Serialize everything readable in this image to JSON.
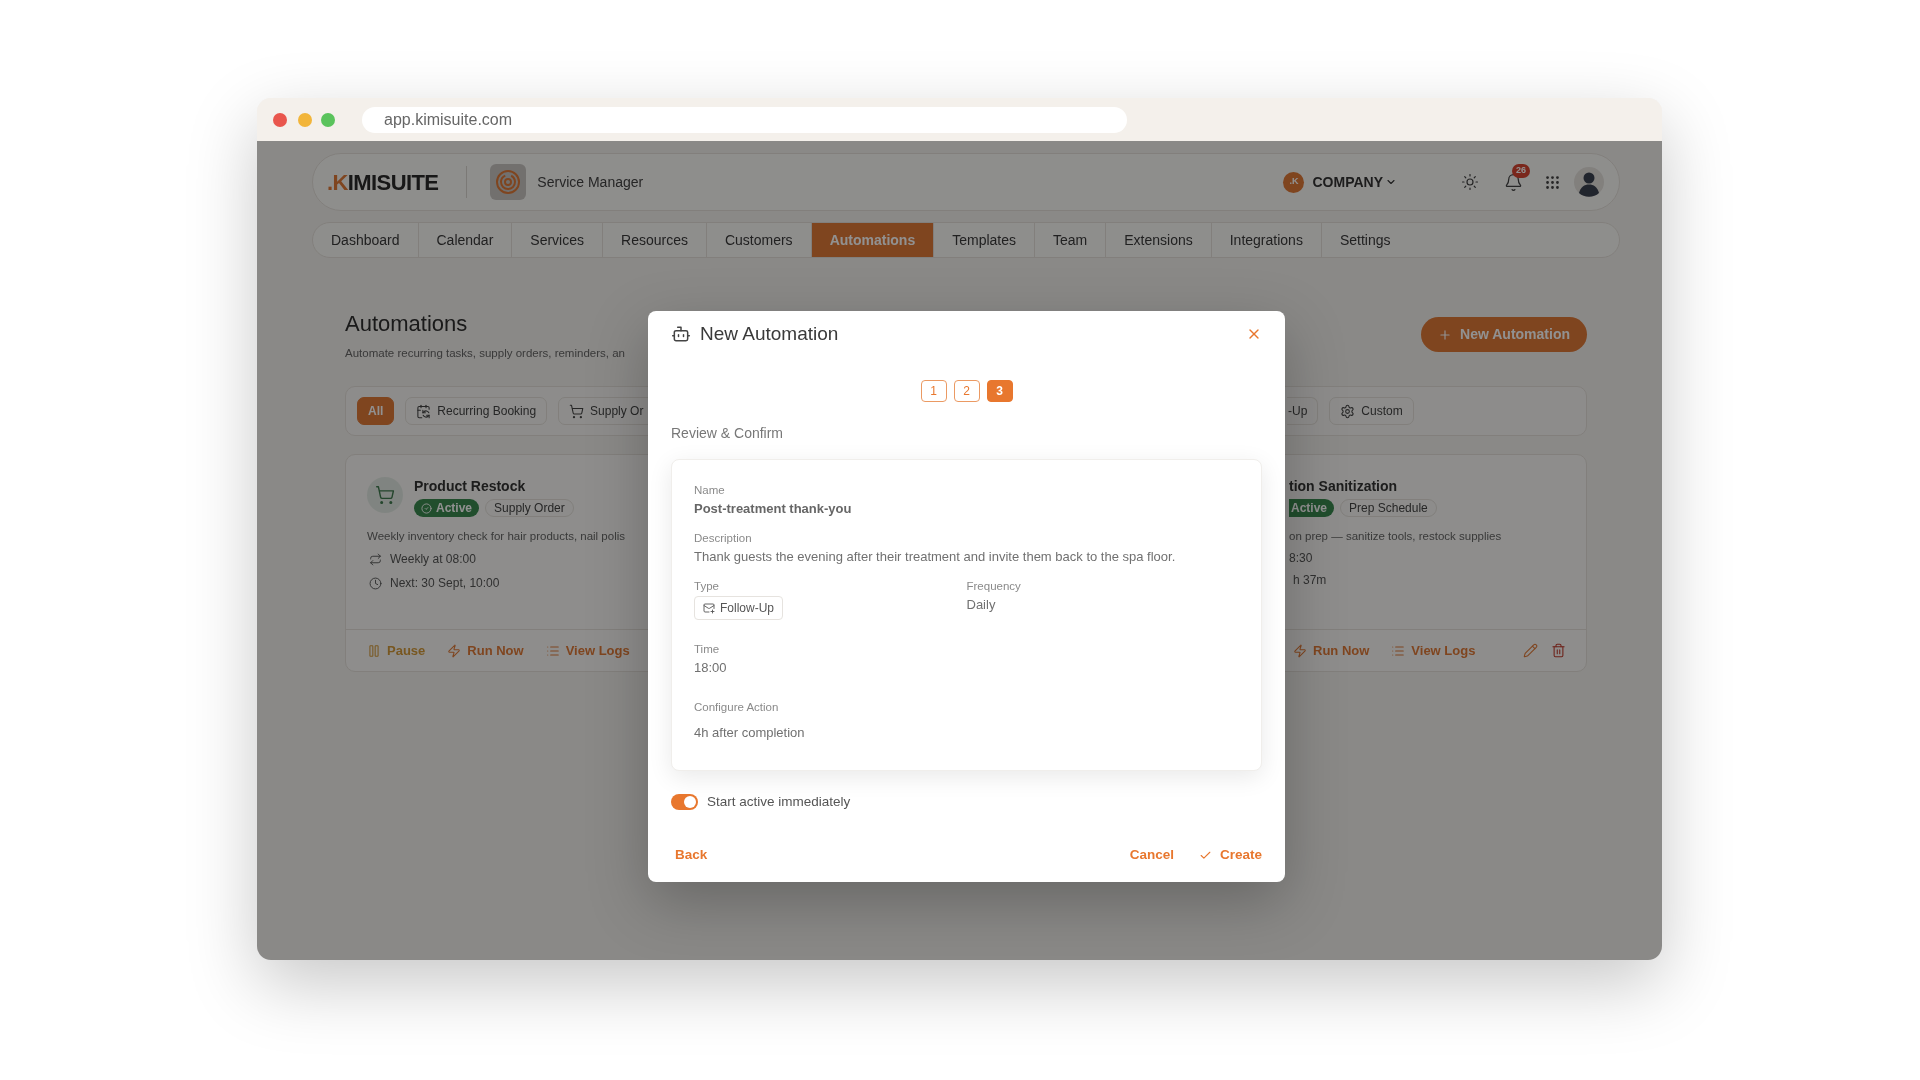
{
  "browser": {
    "url": "app.kimisuite.com"
  },
  "header": {
    "logo": ".KIMISUITE",
    "app_name": "Service Manager",
    "company": {
      "initial": ".K",
      "name": "COMPANY"
    },
    "notification_count": "26"
  },
  "nav": {
    "tabs": [
      {
        "label": "Dashboard",
        "selected": false
      },
      {
        "label": "Calendar",
        "selected": false
      },
      {
        "label": "Services",
        "selected": false
      },
      {
        "label": "Resources",
        "selected": false
      },
      {
        "label": "Customers",
        "selected": false
      },
      {
        "label": "Automations",
        "selected": true
      },
      {
        "label": "Templates",
        "selected": false
      },
      {
        "label": "Team",
        "selected": false
      },
      {
        "label": "Extensions",
        "selected": false
      },
      {
        "label": "Integrations",
        "selected": false
      },
      {
        "label": "Settings",
        "selected": false
      }
    ]
  },
  "page": {
    "title": "Automations",
    "subtitle": "Automate recurring tasks, supply orders, reminders, an",
    "new_button": "New Automation"
  },
  "filters": {
    "left_of_dialog": [
      {
        "label": "All",
        "selected": true
      },
      {
        "label": "Recurring Booking",
        "selected": false
      },
      {
        "label": "Supply Or",
        "selected": false
      }
    ],
    "right_of_dialog": [
      {
        "label": "-Up",
        "selected": false
      },
      {
        "label": "Custom",
        "selected": false
      }
    ]
  },
  "cards": [
    {
      "title": "Product Restock",
      "status": "Active",
      "category": "Supply Order",
      "description": "Weekly inventory check for hair products, nail polis",
      "schedule": "Weekly at 08:00",
      "next_run": "Next: 30 Sept, 10:00",
      "actions": [
        {
          "kind": "pause",
          "label": "Pause"
        },
        {
          "kind": "run",
          "label": "Run Now"
        },
        {
          "kind": "logs",
          "label": "View Logs"
        }
      ]
    },
    {
      "title": "tion Sanitization",
      "status": "Active",
      "category": "Prep Schedule",
      "description": "on prep — sanitize tools, restock supplies",
      "schedule": "8:30",
      "next_run": "h 37m",
      "actions": [
        {
          "kind": "run",
          "label": "Run Now"
        },
        {
          "kind": "logs",
          "label": "View Logs"
        }
      ]
    }
  ],
  "dialog": {
    "title": "New Automation",
    "steps": [
      {
        "label": "1",
        "selected": false
      },
      {
        "label": "2",
        "selected": false
      },
      {
        "label": "3",
        "selected": true
      }
    ],
    "section_title": "Review & Confirm",
    "summary": {
      "name": {
        "label": "Name",
        "value": "Post-treatment thank-you"
      },
      "description": {
        "label": "Description",
        "value": "Thank guests the evening after their treatment and invite them back to the spa floor."
      },
      "type": {
        "label": "Type",
        "value": "Follow-Up"
      },
      "frequency": {
        "label": "Frequency",
        "value": "Daily"
      },
      "time": {
        "label": "Time",
        "value": "18:00"
      },
      "action": {
        "label": "Configure Action",
        "value": "4h after completion"
      }
    },
    "start_active": {
      "label": "Start active immediately",
      "on": true
    },
    "back_button": "Back",
    "cancel_button": "Cancel",
    "create_button": "Create"
  }
}
